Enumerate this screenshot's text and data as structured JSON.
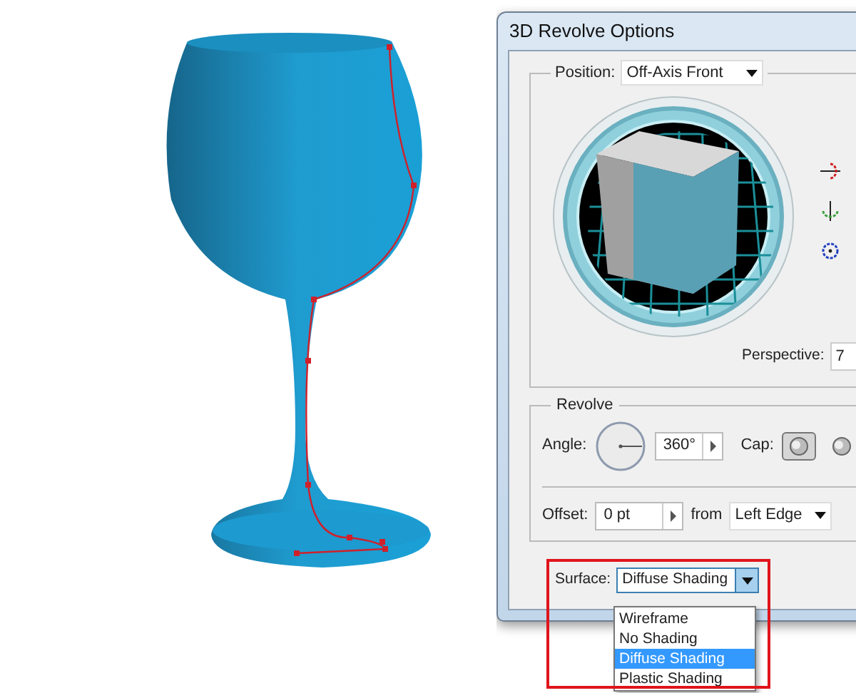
{
  "window": {
    "title": "3D Revolve Options"
  },
  "position": {
    "label": "Position:",
    "value": "Off-Axis Front"
  },
  "perspective": {
    "label": "Perspective:",
    "value": "7"
  },
  "revolve": {
    "title": "Revolve",
    "angle_label": "Angle:",
    "angle_value": "360°",
    "cap_label": "Cap:",
    "cap_options": [
      {
        "selected": true
      },
      {
        "selected": false
      }
    ],
    "offset_label": "Offset:",
    "offset_value": "0 pt",
    "from_label": "from",
    "from_value": "Left Edge"
  },
  "surface": {
    "label": "Surface:",
    "value": "Diffuse Shading",
    "expanded": true,
    "options": [
      {
        "label": "Wireframe",
        "selected": false
      },
      {
        "label": "No Shading",
        "selected": false
      },
      {
        "label": "Diffuse Shading",
        "selected": true
      },
      {
        "label": "Plastic Shading",
        "selected": false
      }
    ]
  }
}
